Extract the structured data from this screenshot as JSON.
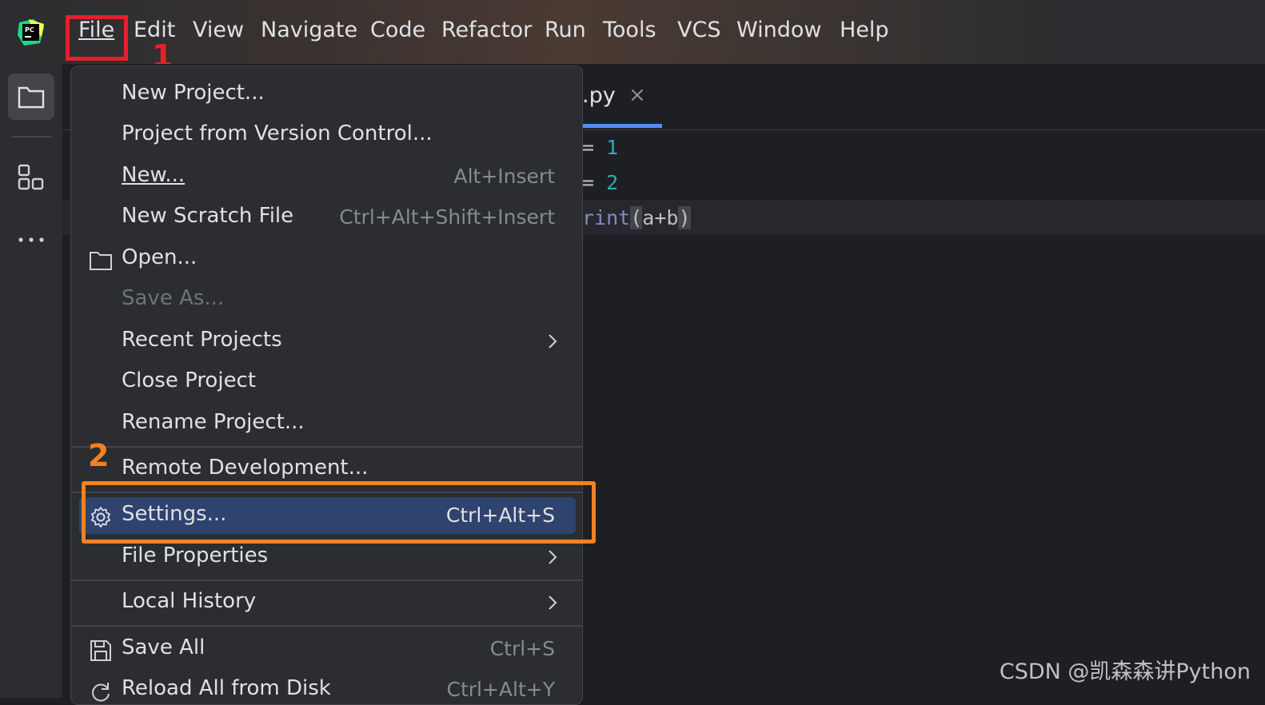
{
  "menubar": {
    "items": [
      {
        "label": "File",
        "mnemonic": "F"
      },
      {
        "label": "Edit",
        "mnemonic": "E"
      },
      {
        "label": "View",
        "mnemonic": "V"
      },
      {
        "label": "Navigate",
        "mnemonic": "N"
      },
      {
        "label": "Code",
        "mnemonic": "C"
      },
      {
        "label": "Refactor",
        "mnemonic": "R"
      },
      {
        "label": "Run",
        "mnemonic": "u"
      },
      {
        "label": "Tools",
        "mnemonic": "T"
      },
      {
        "label": "VCS",
        "mnemonic": "S"
      },
      {
        "label": "Window",
        "mnemonic": "W"
      },
      {
        "label": "Help",
        "mnemonic": "H"
      }
    ],
    "logo_text": "PC"
  },
  "annotations": {
    "step1": "1",
    "step2": "2",
    "step1_color": "#e5202a",
    "step2_color": "#f5801f"
  },
  "editor": {
    "tab_label": ".py",
    "tab_close": "×",
    "lines": [
      {
        "text": "= ",
        "value": "1"
      },
      {
        "text": "= ",
        "value": "2"
      },
      {
        "fn": "rint",
        "open": "(",
        "args": "a+b",
        "close": ")"
      }
    ]
  },
  "file_menu": {
    "items": [
      {
        "label": "New Project...",
        "shortcut": "",
        "enabled": true
      },
      {
        "label": "Project from Version Control...",
        "shortcut": "",
        "enabled": true
      },
      {
        "label": "New...",
        "shortcut": "Alt+Insert",
        "enabled": true
      },
      {
        "label": "New Scratch File",
        "shortcut": "Ctrl+Alt+Shift+Insert",
        "enabled": true
      },
      {
        "label": "Open...",
        "shortcut": "",
        "enabled": true,
        "icon": "folder-icon"
      },
      {
        "label": "Save As...",
        "shortcut": "",
        "enabled": false
      },
      {
        "label": "Recent Projects",
        "shortcut": "",
        "enabled": true,
        "submenu": true
      },
      {
        "label": "Close Project",
        "shortcut": "",
        "enabled": true
      },
      {
        "label": "Rename Project...",
        "shortcut": "",
        "enabled": true
      },
      {
        "label": "Remote Development...",
        "shortcut": "",
        "enabled": true
      },
      {
        "label": "Settings...",
        "shortcut": "Ctrl+Alt+S",
        "enabled": true,
        "icon": "gear-icon",
        "highlighted": true
      },
      {
        "label": "File Properties",
        "shortcut": "",
        "enabled": true,
        "submenu": true
      },
      {
        "label": "Local History",
        "shortcut": "",
        "enabled": true,
        "submenu": true
      },
      {
        "label": "Save All",
        "shortcut": "Ctrl+S",
        "enabled": true,
        "icon": "save-icon"
      },
      {
        "label": "Reload All from Disk",
        "shortcut": "Ctrl+Alt+Y",
        "enabled": true,
        "icon": "reload-icon"
      }
    ]
  },
  "watermark": "CSDN @凯森森讲Python"
}
